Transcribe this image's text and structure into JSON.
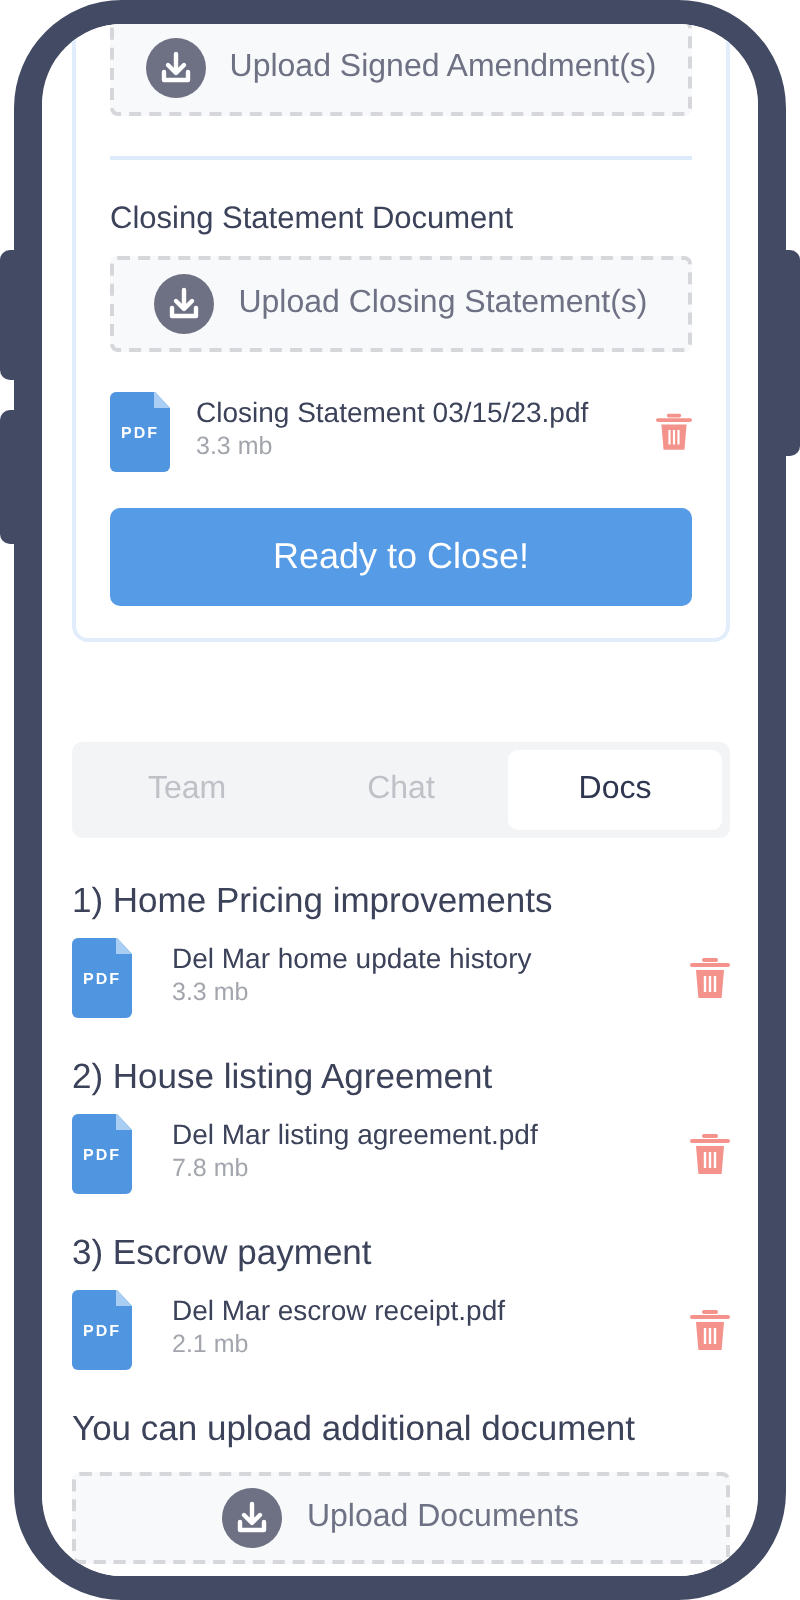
{
  "top_card": {
    "amendment_upload": {
      "label": "Upload Signed Amendment(s)"
    },
    "closing_section": {
      "title": "Closing Statement Document",
      "upload": {
        "label": "Upload Closing Statement(s)"
      },
      "files": [
        {
          "badge": "PDF",
          "name": "Closing Statement 03/15/23.pdf",
          "size": "3.3 mb"
        }
      ]
    },
    "ready_button": "Ready to Close!"
  },
  "tabs": [
    {
      "label": "Team",
      "selected": false
    },
    {
      "label": "Chat",
      "selected": false
    },
    {
      "label": "Docs",
      "selected": true
    }
  ],
  "doc_groups": [
    {
      "title": "1) Home Pricing improvements",
      "files": [
        {
          "badge": "PDF",
          "name": "Del Mar home update history",
          "size": "3.3 mb"
        }
      ]
    },
    {
      "title": "2) House listing Agreement",
      "files": [
        {
          "badge": "PDF",
          "name": "Del Mar listing agreement.pdf",
          "size": "7.8 mb"
        }
      ]
    },
    {
      "title": "3) Escrow payment",
      "files": [
        {
          "badge": "PDF",
          "name": "Del Mar escrow receipt.pdf",
          "size": "2.1 mb"
        }
      ]
    }
  ],
  "additional": {
    "text": "You can upload additional document",
    "upload": {
      "label": "Upload Documents"
    }
  }
}
